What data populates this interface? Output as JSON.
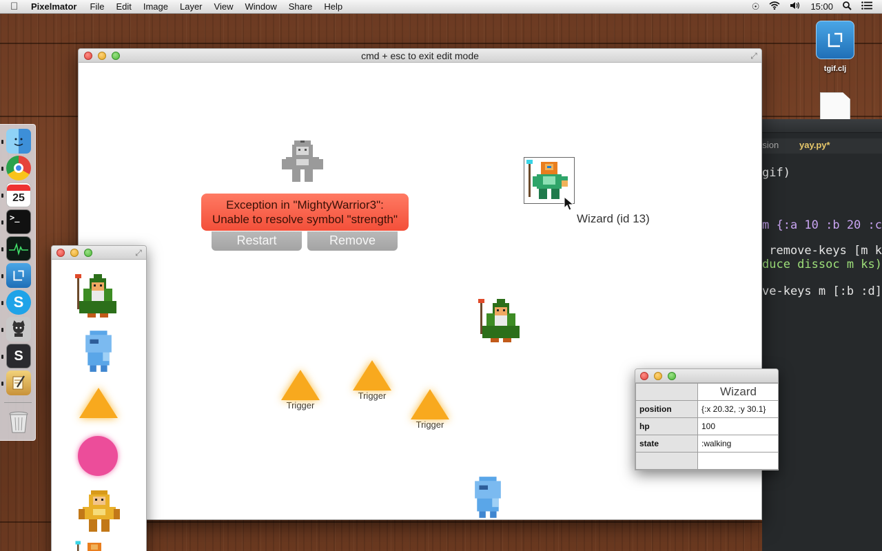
{
  "menubar": {
    "app_name": "Pixelmator",
    "items": [
      "File",
      "Edit",
      "Image",
      "Layer",
      "View",
      "Window",
      "Share",
      "Help"
    ],
    "clock": "15:00"
  },
  "desktop": {
    "icons": [
      {
        "label": "tgif.clj"
      },
      {
        "label": ""
      }
    ]
  },
  "editor": {
    "tabs": [
      "rsion",
      "yay.py*"
    ],
    "lines": [
      "gif)",
      "m {:a 10 :b 20 :c",
      " remove-keys [m ks",
      "duce dissoc m ks))",
      "ve-keys m [:b :d])"
    ]
  },
  "main_window": {
    "title": "cmd + esc to exit edit mode",
    "exception": {
      "line1": "Exception in \"MightyWarrior3\":",
      "line2": "Unable to resolve symbol \"strength\""
    },
    "restart_label": "Restart",
    "remove_label": "Remove",
    "selected_label": "Wizard (id 13)",
    "triggers": [
      "Trigger",
      "Trigger",
      "Trigger"
    ]
  },
  "palette": {
    "items": [
      "wizard-sprite",
      "blue-ghost-sprite",
      "trigger-triangle",
      "pink-circle",
      "warrior-sprite",
      "mage-sprite"
    ]
  },
  "inspector": {
    "header": "Wizard",
    "rows": [
      {
        "key": "position",
        "value": "{:x 20.32, :y 30.1}"
      },
      {
        "key": "hp",
        "value": "100"
      },
      {
        "key": "state",
        "value": ":walking"
      }
    ]
  },
  "colors": {
    "exception_bg": "#f34f39",
    "trigger": "#f8a91e",
    "pink": "#ec4d9a",
    "editor_bg": "#26292b"
  }
}
